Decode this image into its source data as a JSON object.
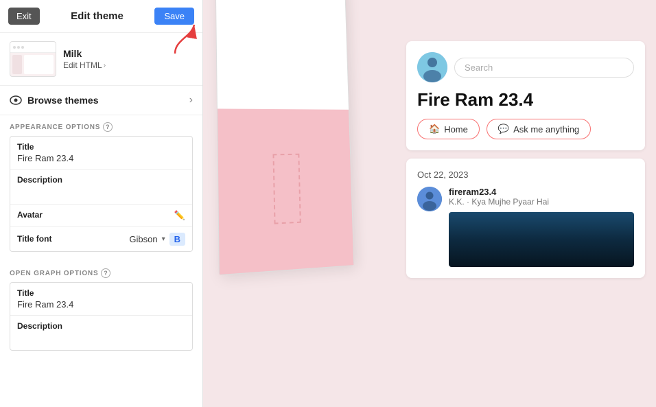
{
  "topBar": {
    "exit_label": "Exit",
    "title": "Edit theme",
    "save_label": "Save"
  },
  "themeCard": {
    "name": "Milk",
    "edit_html_label": "Edit HTML",
    "chevron": "›"
  },
  "browseThemes": {
    "label": "Browse themes",
    "chevron": "›"
  },
  "appearanceSection": {
    "label": "APPEARANCE OPTIONS",
    "help": "?"
  },
  "appearanceFields": {
    "title_label": "Title",
    "title_value": "Fire Ram 23.4",
    "description_label": "Description",
    "description_value": "",
    "avatar_label": "Avatar",
    "title_font_label": "Title font",
    "title_font_value": "Gibson",
    "bold_label": "B"
  },
  "openGraphSection": {
    "label": "OPEN GRAPH OPTIONS",
    "help": "?"
  },
  "openGraphFields": {
    "title_label": "Title",
    "title_value": "Fire Ram 23.4",
    "description_label": "Description",
    "description_value": ""
  },
  "blogPreview": {
    "search_placeholder": "Search",
    "blog_title": "Fire Ram 23.4",
    "home_btn": "Home",
    "ask_btn": "Ask me anything",
    "post_date": "Oct 22, 2023",
    "post_author": "fireram23.4",
    "post_subtitle": "K.K. · Kya Mujhe Pyaar Hai"
  }
}
